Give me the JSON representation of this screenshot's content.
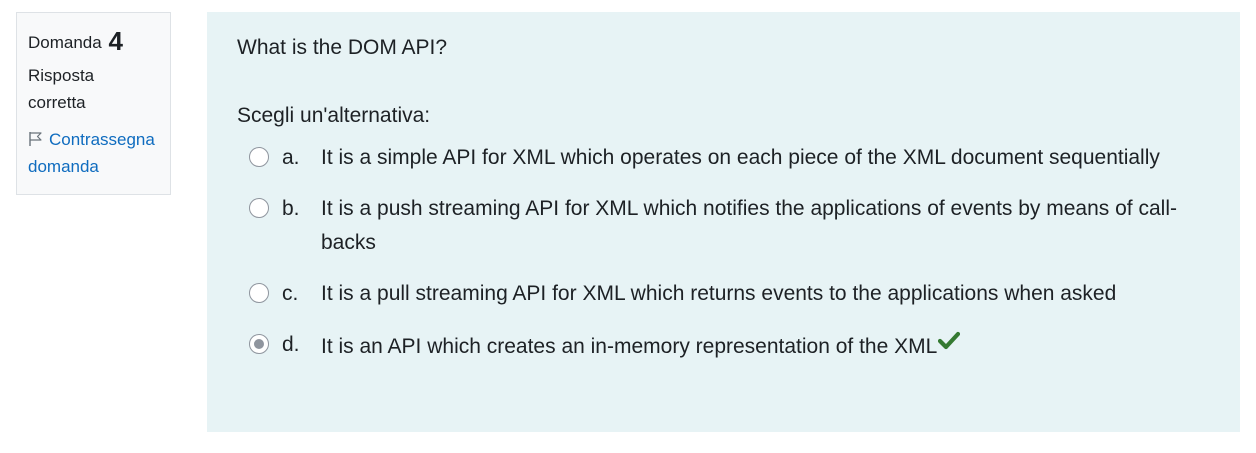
{
  "info": {
    "question_label": "Domanda",
    "question_number": "4",
    "state_line1": "Risposta",
    "state_line2": "corretta",
    "flag_line1": "Contrassegna",
    "flag_line2": "domanda"
  },
  "question": {
    "text": "What is the DOM API?",
    "prompt": "Scegli un'alternativa:",
    "answers": [
      {
        "letter": "a.",
        "text": "It is a simple API for XML which operates on each piece of the XML document sequentially",
        "selected": false
      },
      {
        "letter": "b.",
        "text": "It is a push streaming API for XML which notifies the applications of events by means of call-backs",
        "selected": false
      },
      {
        "letter": "c.",
        "text": "It is a pull streaming API for XML which returns events to the applications when asked",
        "selected": false
      },
      {
        "letter": "d.",
        "text": "It is an API which creates an in-memory representation of the XML",
        "selected": true
      }
    ]
  },
  "colors": {
    "link": "#0f6cbf",
    "correct": "#357a32",
    "content_bg": "#e7f3f5",
    "info_bg": "#f8f9fa"
  },
  "icons": {
    "flag": "flag-icon",
    "correct": "check-icon"
  }
}
